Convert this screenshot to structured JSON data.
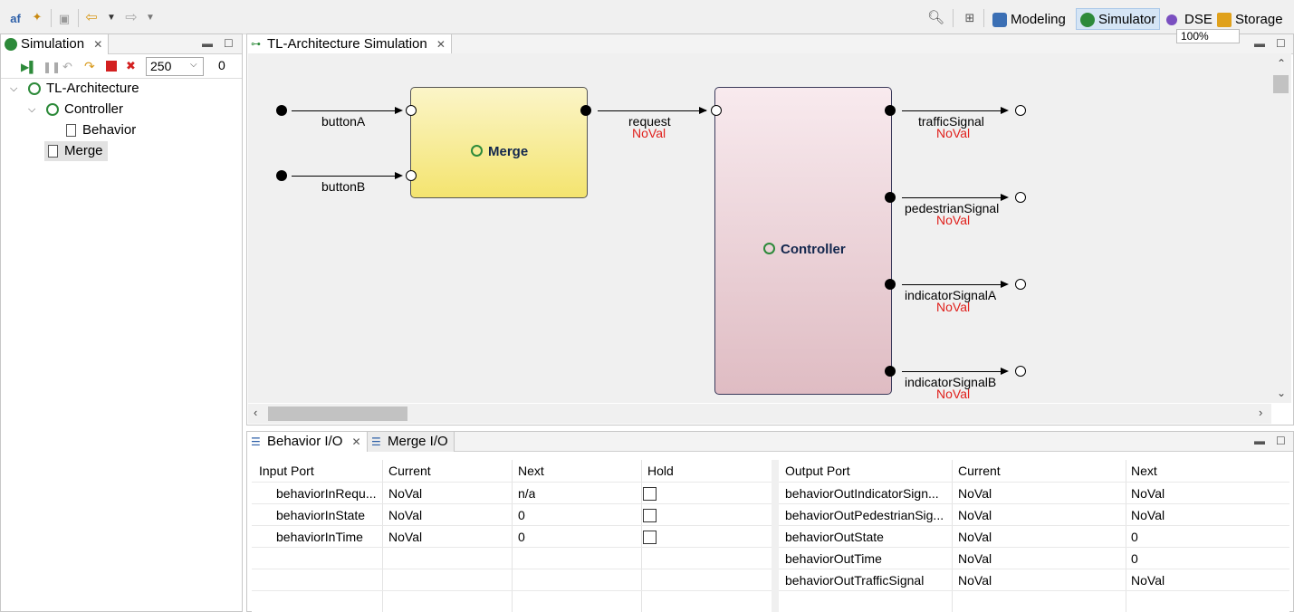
{
  "toolbar": {
    "perspectives": [
      {
        "label": "Modeling",
        "icon": "modeling-icon",
        "color": "#3b6fb4"
      },
      {
        "label": "Simulator",
        "icon": "simulator-icon",
        "color": "#2d8a3a",
        "active": true
      },
      {
        "label": "DSE",
        "icon": "dse-icon",
        "color": "#7a4fc0"
      },
      {
        "label": "Storage",
        "icon": "storage-icon",
        "color": "#e0a11b"
      }
    ]
  },
  "simulation_view": {
    "tab_label": "Simulation",
    "step_value": "250",
    "step_counter": "0",
    "tree": [
      {
        "label": "TL-Architecture",
        "level": 0,
        "expanded": true
      },
      {
        "label": "Controller",
        "level": 1,
        "expanded": true
      },
      {
        "label": "Behavior",
        "level": 2
      },
      {
        "label": "Merge",
        "level": 1,
        "selected": true
      }
    ]
  },
  "diagram": {
    "tab_label": "TL-Architecture Simulation",
    "zoom": "100%",
    "merge_block": {
      "name": "Merge",
      "color_top": "#fbf5c8",
      "color_bottom": "#f4e46f"
    },
    "controller_block": {
      "name": "Controller",
      "color_top": "#f8eaee",
      "color_bottom": "#dfbcc3"
    },
    "inputs": [
      {
        "label": "buttonA"
      },
      {
        "label": "buttonB"
      }
    ],
    "channel": {
      "label": "request",
      "value": "NoVal"
    },
    "outputs": [
      {
        "label": "trafficSignal",
        "value": "NoVal"
      },
      {
        "label": "pedestrianSignal",
        "value": "NoVal"
      },
      {
        "label": "indicatorSignalA",
        "value": "NoVal"
      },
      {
        "label": "indicatorSignalB",
        "value": "NoVal"
      }
    ]
  },
  "io_views": {
    "tabs": [
      "Behavior I/O",
      "Merge I/O"
    ],
    "input_table": {
      "headers": [
        "Input Port",
        "Current",
        "Next",
        "Hold"
      ],
      "rows": [
        {
          "port": "behaviorInRequ...",
          "current": "NoVal",
          "next": "n/a"
        },
        {
          "port": "behaviorInState",
          "current": "NoVal",
          "next": "0"
        },
        {
          "port": "behaviorInTime",
          "current": "NoVal",
          "next": "0"
        }
      ]
    },
    "output_table": {
      "headers": [
        "Output Port",
        "Current",
        "Next"
      ],
      "rows": [
        {
          "port": "behaviorOutIndicatorSign...",
          "current": "NoVal",
          "next": "NoVal"
        },
        {
          "port": "behaviorOutPedestrianSig...",
          "current": "NoVal",
          "next": "NoVal"
        },
        {
          "port": "behaviorOutState",
          "current": "NoVal",
          "next": "0"
        },
        {
          "port": "behaviorOutTime",
          "current": "NoVal",
          "next": "0"
        },
        {
          "port": "behaviorOutTrafficSignal",
          "current": "NoVal",
          "next": "NoVal"
        }
      ]
    }
  }
}
